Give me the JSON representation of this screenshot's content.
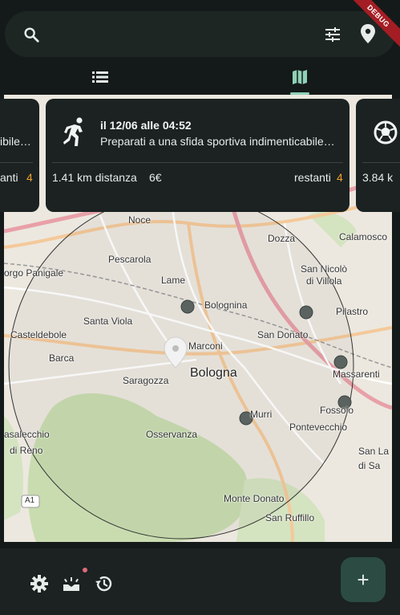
{
  "search": {
    "placeholder": "",
    "value": ""
  },
  "debug_banner": "DEBUG",
  "tabs": [
    {
      "name": "list",
      "icon": "list-icon",
      "active": false
    },
    {
      "name": "map",
      "icon": "map-icon",
      "active": true
    }
  ],
  "cards": {
    "left": {
      "subtitle_partial": "ibile…",
      "remaining_label": "anti",
      "remaining_value": "4"
    },
    "main": {
      "icon": "running-icon",
      "title": "il 12/06 alle 04:52",
      "subtitle": "Preparati a una sfida sportiva indimenticabile…",
      "distance": "1.41 km distanza",
      "price": "6€",
      "remaining_label": "restanti",
      "remaining_value": "4"
    },
    "right": {
      "icon": "soccer-ball-icon",
      "distance_partial": "3.84 k"
    }
  },
  "map": {
    "labels": {
      "noce": "Noce",
      "pescarola": "Pescarola",
      "lame": "Lame",
      "bolognina": "Bolognina",
      "dozza": "Dozza",
      "calamosco": "Calamosco",
      "san_nicolo": "San Nicolò",
      "di_villola": "di Villola",
      "pilastro": "Pilastro",
      "borgo_panigale": "orgo Panigale",
      "santa_viola": "Santa Viola",
      "casteldebole": "Casteldebole",
      "marconi": "Marconi",
      "san_donato": "San Donato",
      "barca": "Barca",
      "saragozza": "Saragozza",
      "bologna": "Bologna",
      "massarenti": "Massarenti",
      "murri": "Murri",
      "fossolo": "Fossolo",
      "pontevecchio": "Pontevecchio",
      "osservanza": "Osservanza",
      "casalecchio": "asalecchio",
      "di_reno": "di Reno",
      "monte_donato": "Monte Donato",
      "san_ruffillo": "San Ruffillo",
      "san_lazzaro": "San La",
      "di_sa": "di Sa",
      "a1": "A1"
    }
  },
  "bottom_bar": {
    "icons": [
      "settings-icon",
      "celebration-icon",
      "history-icon"
    ],
    "fab_label": "+"
  },
  "colors": {
    "accent": "#8fd0b8",
    "orange": "#f0a12c",
    "fab": "#2b4b43",
    "surface": "#1b2221"
  }
}
